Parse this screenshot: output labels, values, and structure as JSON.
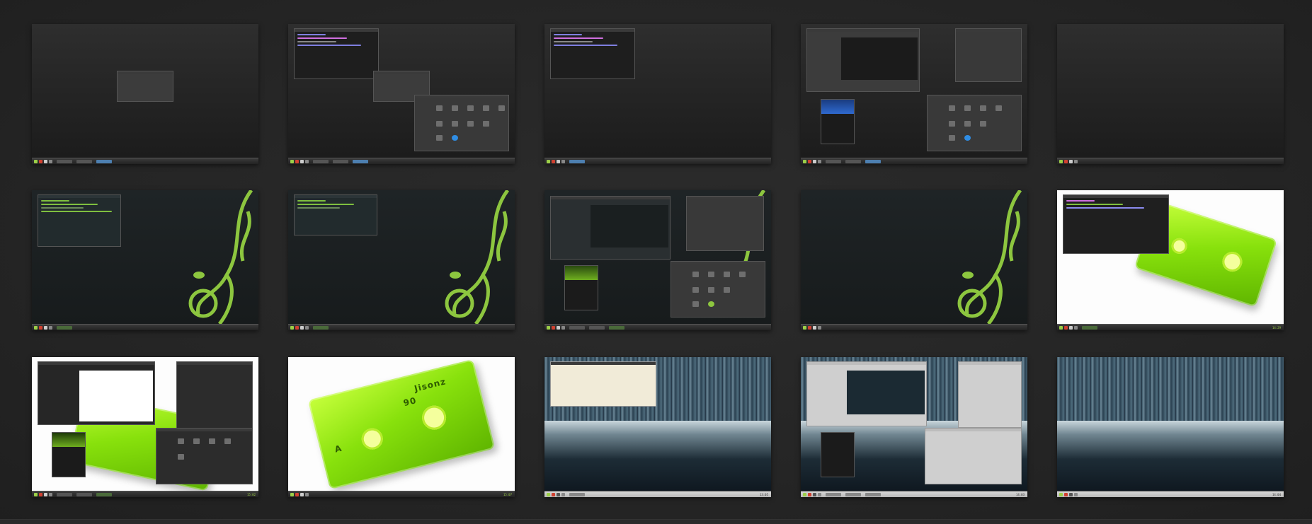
{
  "gallery": {
    "thumbnails": [
      {
        "theme": "dark",
        "label": "",
        "clock": ""
      },
      {
        "theme": "dark",
        "label": "",
        "clock": ""
      },
      {
        "theme": "dark",
        "label": "",
        "clock": ""
      },
      {
        "theme": "dark",
        "label": "",
        "clock": ""
      },
      {
        "theme": "dark",
        "label": "",
        "clock": ""
      },
      {
        "theme": "teal",
        "label": "",
        "clock": ""
      },
      {
        "theme": "teal",
        "label": "",
        "clock": ""
      },
      {
        "theme": "teal",
        "label": "",
        "clock": ""
      },
      {
        "theme": "teal",
        "label": "",
        "clock": ""
      },
      {
        "theme": "white",
        "label": "",
        "clock": "14:29"
      },
      {
        "theme": "white",
        "label": "",
        "clock": "15:02"
      },
      {
        "theme": "white",
        "label": "",
        "clock": "15:07"
      },
      {
        "theme": "night",
        "label": "",
        "clock": "13:05"
      },
      {
        "theme": "night",
        "label": "",
        "clock": "14:03"
      },
      {
        "theme": "night",
        "label": "",
        "clock": "14:04"
      }
    ]
  },
  "cassette": {
    "label": "Jisonz",
    "side": "A",
    "minutes": "90"
  },
  "colors": {
    "accent_green": "#9ccf48",
    "task_active": "#4d7fb0",
    "help_icon": "#2f8de4",
    "background": "#252525"
  },
  "icons": [
    "terminal-icon",
    "file-manager-icon",
    "settings-icon",
    "browser-icon",
    "help-icon",
    "chameleon-logo"
  ]
}
